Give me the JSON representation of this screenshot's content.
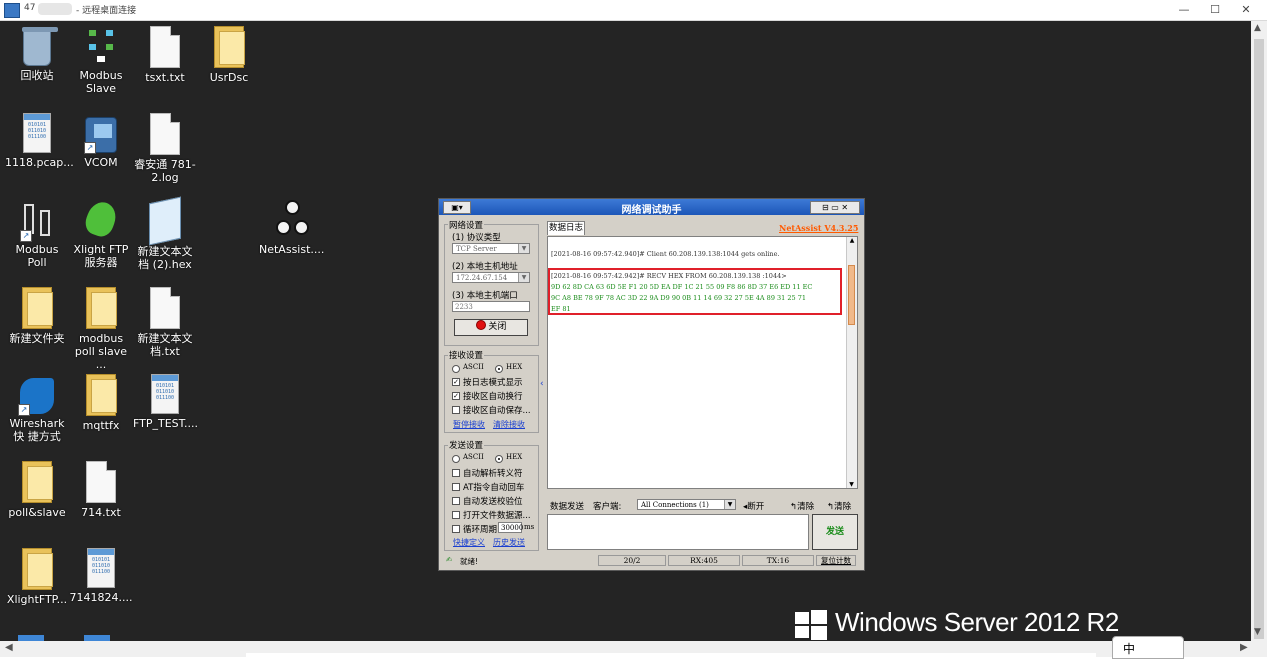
{
  "rdp": {
    "ip_prefix": "47",
    "title": "- 远程桌面连接",
    "controls": {
      "minimize": "—",
      "maximize": "☐",
      "close": "✕"
    }
  },
  "desktop_icons": [
    {
      "label": "回收站"
    },
    {
      "label": "Modbus Slave"
    },
    {
      "label": "tsxt.txt"
    },
    {
      "label": "UsrDsc"
    },
    {
      "label": "1118.pcap..."
    },
    {
      "label": "VCOM"
    },
    {
      "label": "睿安通 781-2.log"
    },
    {
      "label": "Modbus Poll"
    },
    {
      "label": "Xlight FTP 服务器"
    },
    {
      "label": "新建文本文档 (2).hex"
    },
    {
      "label": "NetAssist...."
    },
    {
      "label": "新建文件夹"
    },
    {
      "label": "modbus poll slave ..."
    },
    {
      "label": "新建文本文 档.txt"
    },
    {
      "label": "Wireshark 快 捷方式"
    },
    {
      "label": "mqttfx"
    },
    {
      "label": "FTP_TEST...."
    },
    {
      "label": "poll&slave"
    },
    {
      "label": "714.txt"
    },
    {
      "label": "XlightFTP..."
    },
    {
      "label": "7141824...."
    }
  ],
  "branding": {
    "os_text": "Windows Server 2012 R2",
    "tray_text": "中"
  },
  "netassist": {
    "title": "网络调试助手",
    "version_link": "NetAssist V4.3.25",
    "net_settings": {
      "group_title": "网络设置",
      "protocol_label": "(1) 协议类型",
      "protocol_value": "TCP Server",
      "host_label": "(2) 本地主机地址",
      "host_value": "172.24.67.154",
      "port_label": "(3) 本地主机端口",
      "port_value": "2233",
      "close_button": "关闭"
    },
    "recv_settings": {
      "group_title": "接收设置",
      "ascii": "ASCII",
      "hex": "HEX",
      "opt_log_mode": "按日志模式显示",
      "opt_auto_wrap": "接收区自动换行",
      "opt_auto_save": "接收区自动保存...",
      "link_pause": "暂停接收",
      "link_clear": "清除接收"
    },
    "send_settings": {
      "group_title": "发送设置",
      "ascii": "ASCII",
      "hex": "HEX",
      "opt_parse_escape": "自动解析转义符",
      "opt_at_crlf": "AT指令自动回车",
      "opt_checksum": "自动发送校验位",
      "opt_file_source": "打开文件数据源...",
      "opt_loop": "循环周期",
      "loop_value": "30000",
      "loop_unit": "ms",
      "link_shortcut": "快捷定义",
      "link_history": "历史发送"
    },
    "log": {
      "tab_label": "数据日志",
      "line1": "[2021-08-16 09:57:42.940]# Client 60.208.139.138:1044 gets online.",
      "line2": "[2021-08-16 09:57:42.942]# RECV HEX FROM 60.208.139.138 :1044>",
      "hex1": "9D 62 8D CA 63 6D 5E F1 20 5D EA DF 1C 21 55 09 F8 86 8D 37 E6 ED 11 EC",
      "hex2": "9C A8 BE 78 9F 78 AC 3D 22 9A D9 90 0B 11 14 69 32 27 5E 4A 89 31 25 71",
      "hex3": "EF 81"
    },
    "send_bar": {
      "tab_label": "数据发送",
      "client_label": "客户端:",
      "client_value": "All Connections (1)",
      "disconnect": "断开",
      "clear1": "清除",
      "clear2": "清除",
      "send_button": "发送"
    },
    "status": {
      "ready": "就绪!",
      "counter": "20/2",
      "rx": "RX:405",
      "tx": "TX:16",
      "reset": "复位计数"
    }
  }
}
